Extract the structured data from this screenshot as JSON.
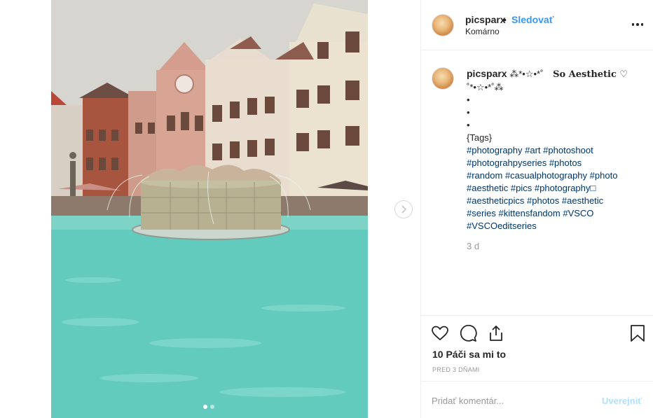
{
  "post": {
    "username": "picsparx",
    "separator": "•",
    "follow_label": "Sledovať",
    "location": "Komárno",
    "image_alt": "Fountain with turquoise water in front of colorful gabled buildings",
    "carousel": {
      "count": 2,
      "active_index": 0
    }
  },
  "caption": {
    "username": "picsparx",
    "decor1": "⁂*•☆•*˚",
    "title": "So Aesthetic ♡",
    "decor2": "˚*•☆•*˚⁂",
    "bullets": [
      "•",
      "•",
      "•"
    ],
    "tags_header": "{Tags}",
    "hashtag_lines": [
      [
        "#photography",
        "#art",
        "#photoshoot"
      ],
      [
        "#photograhpyseries",
        "#photos"
      ],
      [
        "#random",
        "#casualphotography",
        "#photo"
      ],
      [
        "#aesthetic",
        "#pics",
        "#photography□"
      ],
      [
        "#aestheticpics",
        "#photos",
        "#aesthetic"
      ],
      [
        "#series",
        "#kittensfandom",
        "#VSCO"
      ],
      [
        "#VSCOeditseries"
      ]
    ],
    "time": "3 d"
  },
  "actions": {
    "like_icon": "heart-icon",
    "comment_icon": "comment-icon",
    "share_icon": "share-icon",
    "save_icon": "bookmark-icon",
    "likes_text": "10 Páči sa mi to",
    "posted_ago": "PRED 3 DŇAMI"
  },
  "comment": {
    "placeholder": "Pridať komentár...",
    "post_label": "Uverejniť"
  },
  "colors": {
    "link_blue": "#3897f0",
    "hashtag_blue": "#003569",
    "muted_gray": "#999999",
    "post_disabled": "#b2dffc",
    "water_teal": "#5ec7b8"
  }
}
